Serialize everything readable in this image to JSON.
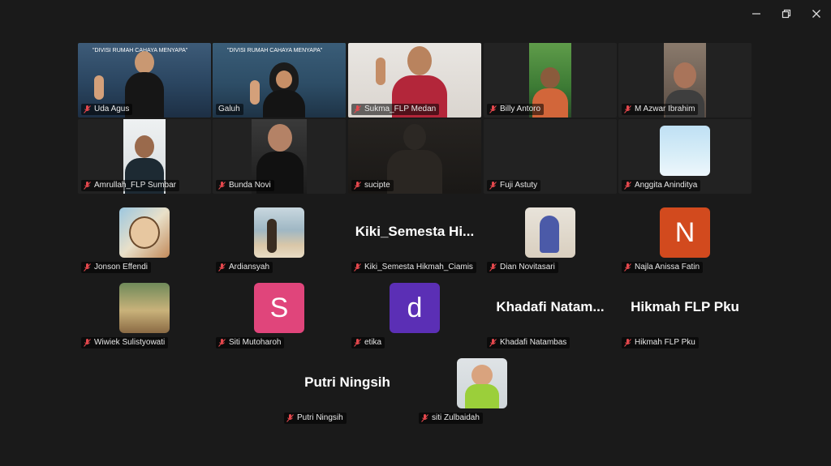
{
  "window_controls": {
    "minimize": "minimize-icon",
    "restore": "restore-icon",
    "close": "close-icon"
  },
  "banner_text": "\"DIVISI RUMAH CAHAYA MENYAPA\"",
  "participants": [
    {
      "name": "Uda Agus"
    },
    {
      "name": "Galuh"
    },
    {
      "name": "Sukma_FLP Medan"
    },
    {
      "name": "Billy Antoro"
    },
    {
      "name": "M Azwar Ibrahim"
    },
    {
      "name": "Amrullah_FLP Sumbar"
    },
    {
      "name": "Bunda Novi"
    },
    {
      "name": "sucipte"
    },
    {
      "name": "Fuji Astuty"
    },
    {
      "name": "Anggita Aninditya"
    },
    {
      "name": "Jonson Effendi"
    },
    {
      "name": "Ardiansyah"
    },
    {
      "name": "Kiki_Semesta Hikmah_Ciamis",
      "display": "Kiki_Semesta  Hi..."
    },
    {
      "name": "Dian Novitasari"
    },
    {
      "name": "Najla Anissa Fatin",
      "initial": "N"
    },
    {
      "name": "Wiwiek Sulistyowati"
    },
    {
      "name": "Siti Mutoharoh",
      "initial": "S"
    },
    {
      "name": "etika",
      "initial": "d"
    },
    {
      "name": "Khadafi Natambas",
      "display": "Khadafi  Natam..."
    },
    {
      "name": "Hikmah FLP Pku",
      "display": "Hikmah FLP Pku"
    },
    {
      "name": "Putri Ningsih",
      "display": "Putri Ningsih"
    },
    {
      "name": "siti Zulbaidah"
    }
  ],
  "colors": {
    "background": "#1a1a1a",
    "active_border": "#2ec27e",
    "muted_mic": "#e5484d",
    "avatar_n": "#d24a1e",
    "avatar_s": "#e0457b",
    "avatar_d": "#5b2fb5"
  }
}
